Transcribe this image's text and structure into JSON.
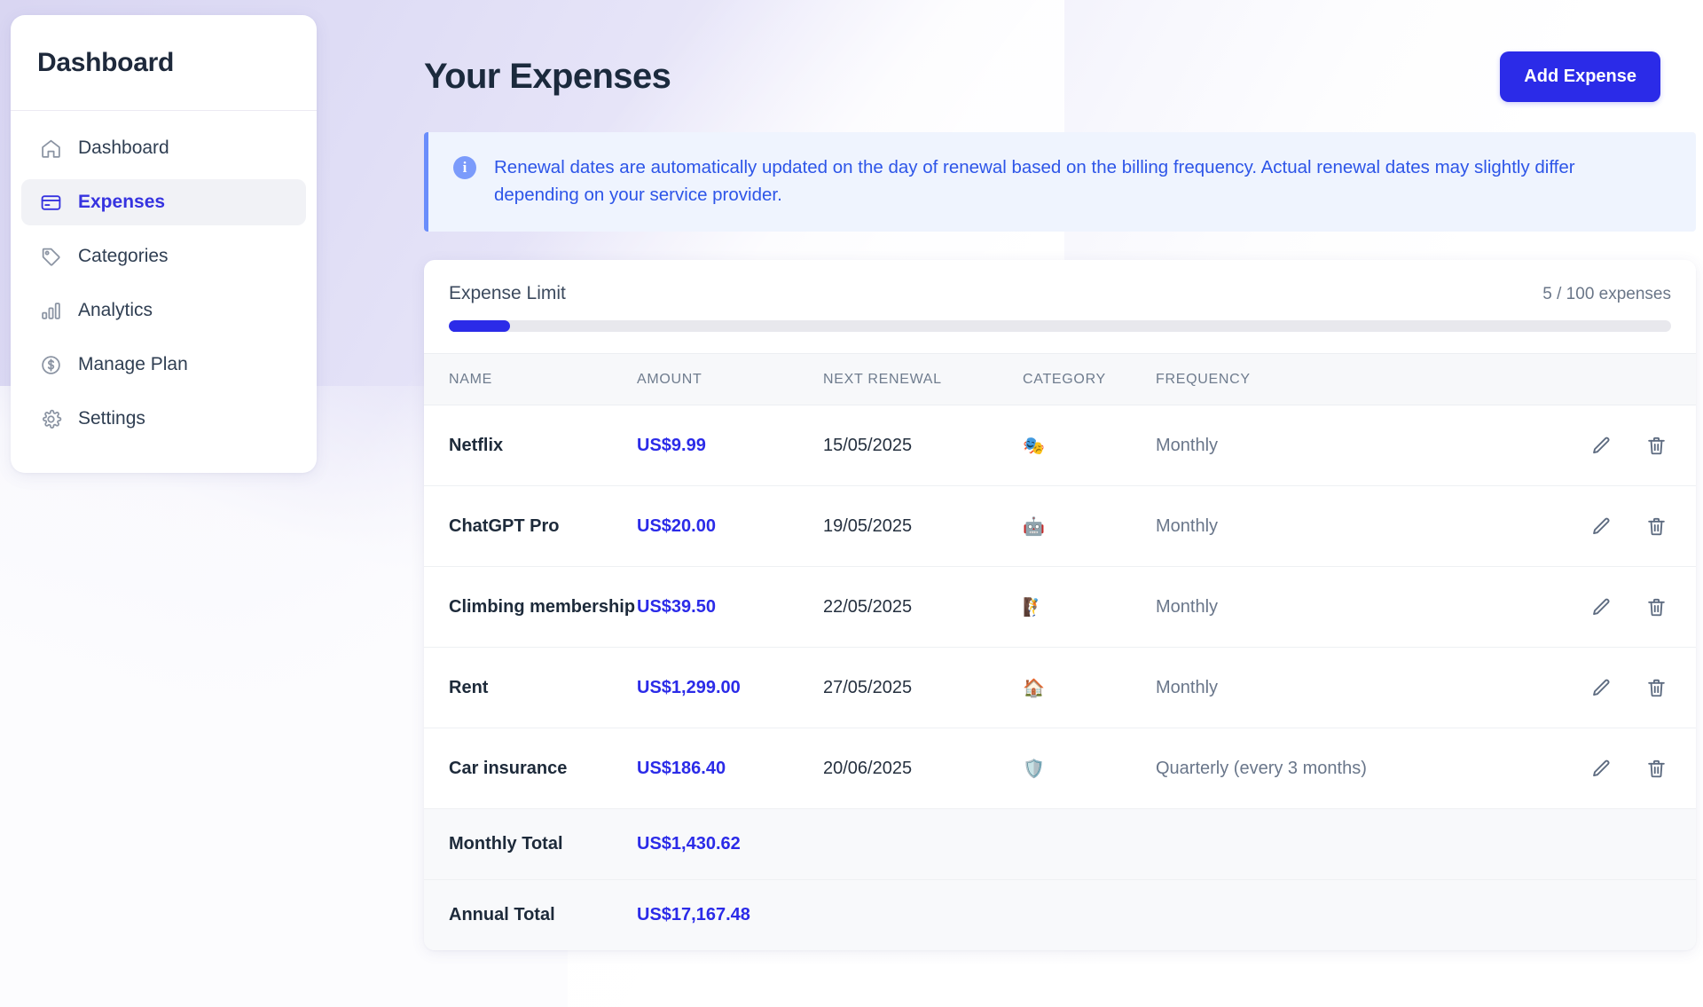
{
  "sidebar": {
    "title": "Dashboard",
    "items": [
      {
        "label": "Dashboard",
        "icon": "home-icon",
        "active": false
      },
      {
        "label": "Expenses",
        "icon": "credit-card-icon",
        "active": true
      },
      {
        "label": "Categories",
        "icon": "tag-icon",
        "active": false
      },
      {
        "label": "Analytics",
        "icon": "bar-chart-icon",
        "active": false
      },
      {
        "label": "Manage Plan",
        "icon": "dollar-circle-icon",
        "active": false
      },
      {
        "label": "Settings",
        "icon": "gear-icon",
        "active": false
      }
    ]
  },
  "header": {
    "title": "Your Expenses",
    "add_expense_label": "Add Expense"
  },
  "banner": {
    "icon": "info-icon",
    "text": "Renewal dates are automatically updated on the day of renewal based on the billing frequency. Actual renewal dates may slightly differ depending on your service provider."
  },
  "limit": {
    "label": "Expense Limit",
    "count_text": "5 / 100 expenses",
    "used": 5,
    "total": 100,
    "percent": 5
  },
  "table": {
    "columns": [
      "NAME",
      "AMOUNT",
      "NEXT RENEWAL",
      "CATEGORY",
      "FREQUENCY"
    ],
    "rows": [
      {
        "name": "Netflix",
        "amount": "US$9.99",
        "renewal": "15/05/2025",
        "category_emoji": "🎭",
        "category_name": "entertainment",
        "frequency": "Monthly"
      },
      {
        "name": "ChatGPT Pro",
        "amount": "US$20.00",
        "renewal": "19/05/2025",
        "category_emoji": "🤖",
        "category_name": "technology",
        "frequency": "Monthly"
      },
      {
        "name": "Climbing membership",
        "amount": "US$39.50",
        "renewal": "22/05/2025",
        "category_emoji": "🧗",
        "category_name": "fitness",
        "frequency": "Monthly"
      },
      {
        "name": "Rent",
        "amount": "US$1,299.00",
        "renewal": "27/05/2025",
        "category_emoji": "🏠",
        "category_name": "housing",
        "frequency": "Monthly"
      },
      {
        "name": "Car insurance",
        "amount": "US$186.40",
        "renewal": "20/06/2025",
        "category_emoji": "🛡️",
        "category_name": "insurance",
        "frequency": "Quarterly (every 3 months)"
      }
    ],
    "totals": [
      {
        "label": "Monthly Total",
        "amount": "US$1,430.62"
      },
      {
        "label": "Annual Total",
        "amount": "US$17,167.48"
      }
    ],
    "row_actions": {
      "edit": "edit-icon",
      "delete": "delete-icon"
    }
  },
  "colors": {
    "accent": "#2b2be8",
    "banner_text": "#2d55e8",
    "banner_bg": "#eff4fe",
    "title": "#1b2a3d",
    "muted": "#69768a"
  }
}
